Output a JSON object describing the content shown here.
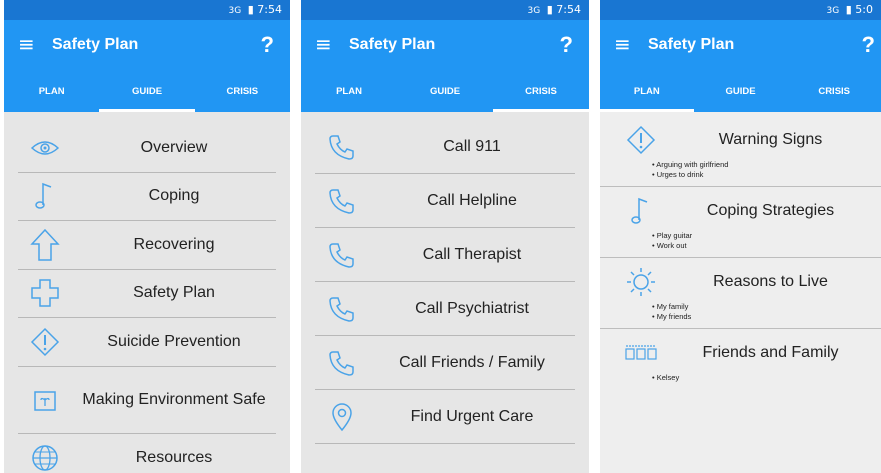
{
  "status": {
    "signal": "3G",
    "p1_time": "7:54",
    "p2_time": "7:54",
    "p3_time": "5:0"
  },
  "app": {
    "title": "Safety Plan",
    "help": "?"
  },
  "tabs": [
    "PLAN",
    "GUIDE",
    "CRISIS"
  ],
  "guide_list": [
    {
      "label": "Overview",
      "icon": "eye-icon"
    },
    {
      "label": "Coping",
      "icon": "music-note-icon"
    },
    {
      "label": "Recovering",
      "icon": "up-arrow-icon"
    },
    {
      "label": "Safety Plan",
      "icon": "plus-cross-icon"
    },
    {
      "label": "Suicide Prevention",
      "icon": "warning-diamond-icon"
    },
    {
      "label": "Making Environment Safe",
      "icon": "plant-box-icon"
    },
    {
      "label": "Resources",
      "icon": "globe-icon"
    }
  ],
  "crisis_list": [
    {
      "label": "Call 911",
      "icon": "phone-icon"
    },
    {
      "label": "Call Helpline",
      "icon": "phone-icon"
    },
    {
      "label": "Call Therapist",
      "icon": "phone-icon"
    },
    {
      "label": "Call Psychiatrist",
      "icon": "phone-icon"
    },
    {
      "label": "Call Friends / Family",
      "icon": "phone-icon"
    },
    {
      "label": "Find Urgent Care",
      "icon": "location-pin-icon"
    }
  ],
  "plan_sections": [
    {
      "title": "Warning Signs",
      "icon": "warning-diamond-icon",
      "items": [
        "Arguing with girlfriend",
        "Urges to drink"
      ]
    },
    {
      "title": "Coping Strategies",
      "icon": "music-note-icon",
      "items": [
        "Play guitar",
        "Work out"
      ]
    },
    {
      "title": "Reasons to Live",
      "icon": "sun-icon",
      "items": [
        "My family",
        "My friends"
      ]
    },
    {
      "title": "Friends and Family",
      "icon": "contacts-icon",
      "items": [
        "Kelsey"
      ]
    }
  ],
  "colors": {
    "appbar": "#2196f3",
    "statusbar": "#1976d2",
    "icon": "#4aa3e8"
  }
}
